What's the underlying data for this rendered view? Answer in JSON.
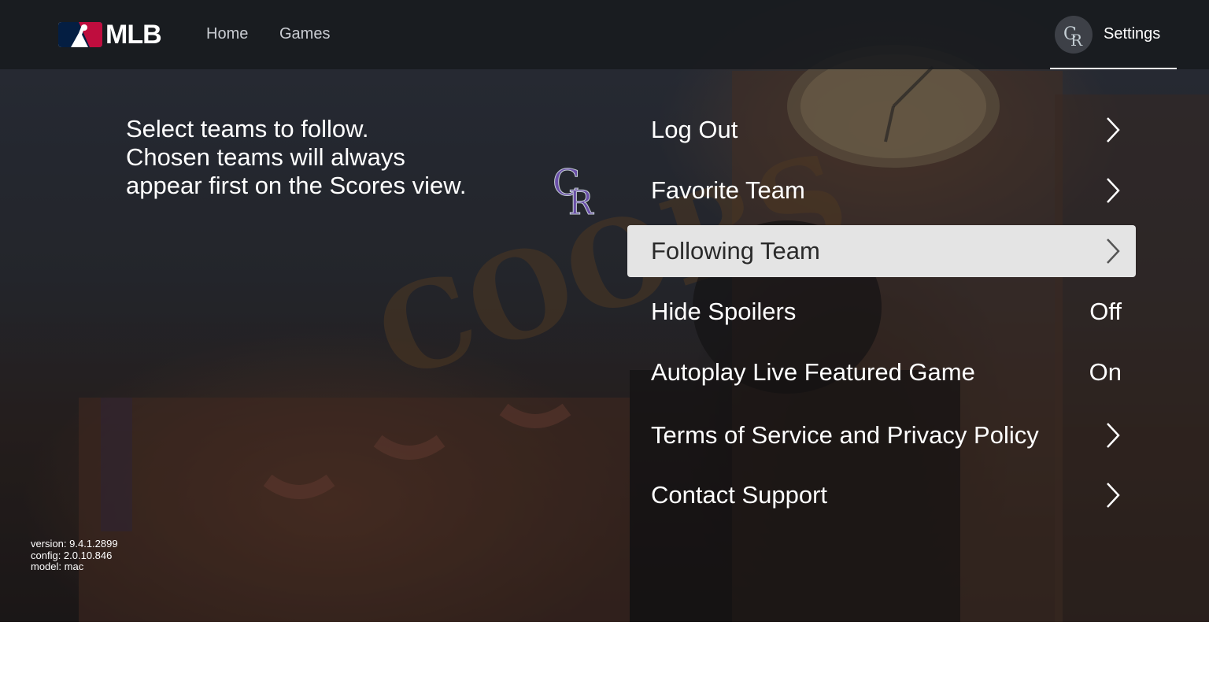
{
  "nav": {
    "logo_text": "MLB",
    "home_label": "Home",
    "games_label": "Games",
    "settings_label": "Settings"
  },
  "description": {
    "line1": "Select teams to follow.",
    "line2": "Chosen teams will always",
    "line3": "appear first on the Scores view."
  },
  "team_logo": {
    "letters": "CR",
    "color": "#33006F"
  },
  "menu": {
    "items": [
      {
        "label": "Log Out",
        "control": "chevron"
      },
      {
        "label": "Favorite Team",
        "control": "chevron"
      },
      {
        "label": "Following Team",
        "control": "chevron",
        "selected": true
      },
      {
        "label": "Hide Spoilers",
        "value": "Off"
      },
      {
        "label": "Autoplay Live Featured Game",
        "value": "On"
      },
      {
        "label": "Terms of Service and Privacy Policy",
        "control": "chevron"
      },
      {
        "label": "Contact Support",
        "control": "chevron"
      }
    ]
  },
  "version_info": {
    "version": "version: 9.4.1.2899",
    "config": "config: 2.0.10.846",
    "model": "model: mac"
  },
  "colors": {
    "mlb_blue": "#041E42",
    "mlb_red": "#BF0D3E",
    "selected_row": "#e4e4e4"
  }
}
